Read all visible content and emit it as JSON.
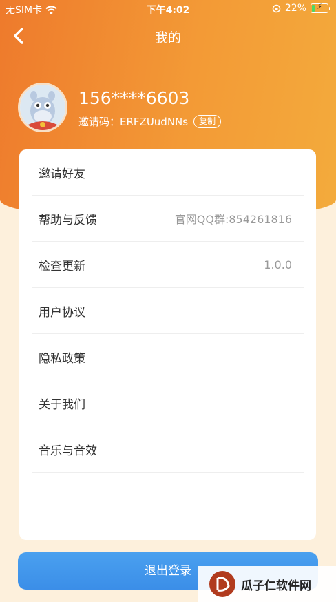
{
  "status_bar": {
    "carrier": "无SIM卡",
    "time": "下午4:02",
    "battery_pct": "22%",
    "battery_level": 0.22
  },
  "nav": {
    "title": "我的",
    "back_icon": "chevron-left-icon"
  },
  "profile": {
    "phone": "156****6603",
    "invite_label": "邀请码：",
    "invite_code": "ERFZUudNNs",
    "copy_label": "复制"
  },
  "menu": [
    {
      "label": "邀请好友",
      "value": ""
    },
    {
      "label": "帮助与反馈",
      "value": "官网QQ群:854261816"
    },
    {
      "label": "检查更新",
      "value": "1.0.0"
    },
    {
      "label": "用户协议",
      "value": ""
    },
    {
      "label": "隐私政策",
      "value": ""
    },
    {
      "label": "关于我们",
      "value": ""
    },
    {
      "label": "音乐与音效",
      "value": ""
    }
  ],
  "logout_label": "退出登录",
  "watermark": {
    "text": "瓜子仁软件网"
  },
  "colors": {
    "header_start": "#ee7a2c",
    "header_end": "#f3ab3c",
    "page_bg": "#fdf0dc",
    "button": "#3b8ee8"
  }
}
